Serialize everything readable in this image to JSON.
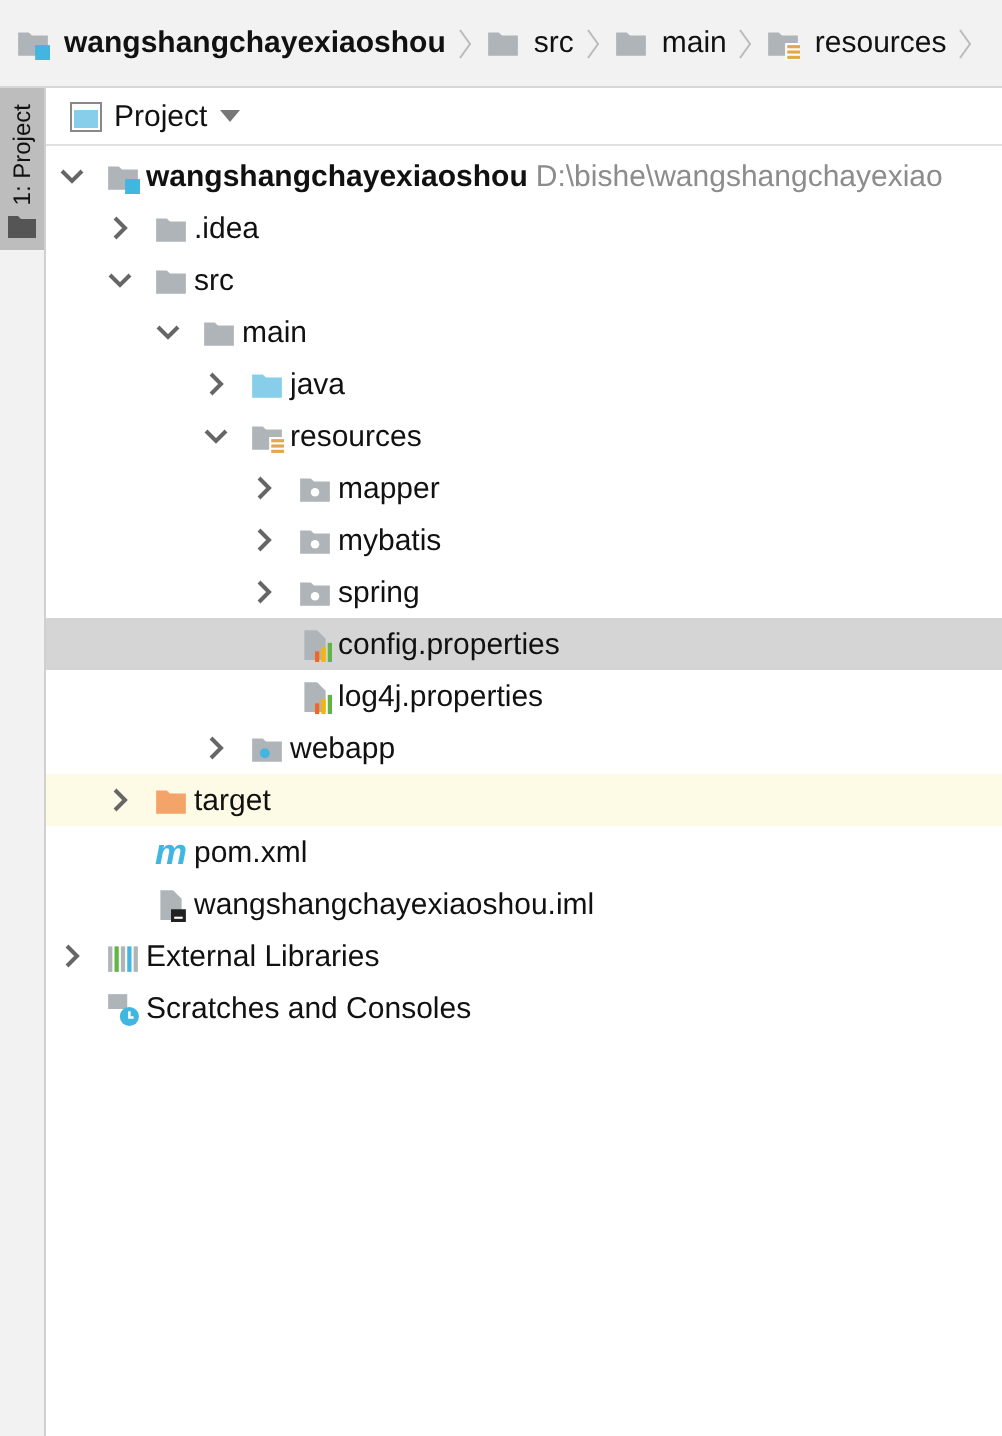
{
  "breadcrumb": [
    {
      "label": "wangshangchayexiaoshou",
      "kind": "module"
    },
    {
      "label": "src",
      "kind": "folder"
    },
    {
      "label": "main",
      "kind": "folder"
    },
    {
      "label": "resources",
      "kind": "resources"
    }
  ],
  "tool_strip": {
    "tab": {
      "label": "1: Project",
      "selected": true
    }
  },
  "panel": {
    "title": "Project"
  },
  "tree": [
    {
      "label": "wangshangchayexiaoshou",
      "kind": "module",
      "path": "D:\\bishe\\wangshangchayexiao",
      "expanded": true,
      "selected": false,
      "highlighted": false,
      "children": [
        {
          "label": ".idea",
          "kind": "folder",
          "expanded": false,
          "selected": false,
          "highlighted": false
        },
        {
          "label": "src",
          "kind": "folder",
          "expanded": true,
          "selected": false,
          "highlighted": false,
          "children": [
            {
              "label": "main",
              "kind": "folder",
              "expanded": true,
              "selected": false,
              "highlighted": false,
              "children": [
                {
                  "label": "java",
                  "kind": "source",
                  "expanded": false,
                  "selected": false,
                  "highlighted": false
                },
                {
                  "label": "resources",
                  "kind": "resources",
                  "expanded": true,
                  "selected": false,
                  "highlighted": false,
                  "children": [
                    {
                      "label": "mapper",
                      "kind": "package",
                      "expanded": false,
                      "selected": false,
                      "highlighted": false
                    },
                    {
                      "label": "mybatis",
                      "kind": "package",
                      "expanded": false,
                      "selected": false,
                      "highlighted": false
                    },
                    {
                      "label": "spring",
                      "kind": "package",
                      "expanded": false,
                      "selected": false,
                      "highlighted": false
                    },
                    {
                      "label": "config.properties",
                      "kind": "properties",
                      "selected": true,
                      "highlighted": false
                    },
                    {
                      "label": "log4j.properties",
                      "kind": "properties",
                      "selected": false,
                      "highlighted": false
                    }
                  ]
                },
                {
                  "label": "webapp",
                  "kind": "web",
                  "expanded": false,
                  "selected": false,
                  "highlighted": false
                }
              ]
            }
          ]
        },
        {
          "label": "target",
          "kind": "excluded",
          "expanded": false,
          "selected": false,
          "highlighted": true
        },
        {
          "label": "pom.xml",
          "kind": "maven",
          "icon_text": "m",
          "selected": false,
          "highlighted": false
        },
        {
          "label": "wangshangchayexiaoshou.iml",
          "kind": "iml",
          "selected": false,
          "highlighted": false
        }
      ]
    },
    {
      "label": "External Libraries",
      "kind": "libraries",
      "expanded": false,
      "selected": false,
      "highlighted": false
    },
    {
      "label": "Scratches and Consoles",
      "kind": "scratches",
      "selected": false,
      "highlighted": false
    }
  ]
}
